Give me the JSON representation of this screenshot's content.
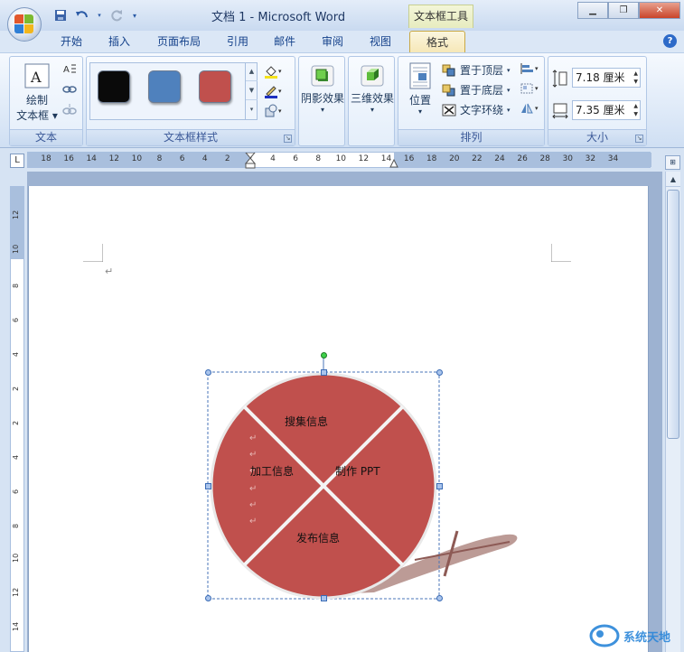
{
  "titlebar": {
    "document_title": "文档 1 - Microsoft Word",
    "contextual_tab_title": "文本框工具",
    "window_buttons": [
      "minimize",
      "restore",
      "close"
    ]
  },
  "tabs": [
    {
      "label": "开始",
      "active": false
    },
    {
      "label": "插入",
      "active": false
    },
    {
      "label": "页面布局",
      "active": false
    },
    {
      "label": "引用",
      "active": false
    },
    {
      "label": "邮件",
      "active": false
    },
    {
      "label": "审阅",
      "active": false
    },
    {
      "label": "视图",
      "active": false
    },
    {
      "label": "格式",
      "active": true
    }
  ],
  "ribbon": {
    "text_group": {
      "label": "文本",
      "draw_textbox_line1": "绘制",
      "draw_textbox_line2": "文本框"
    },
    "textbox_styles_group": {
      "label": "文本框样式",
      "swatches": [
        "#0a0a0a",
        "#4f81bd",
        "#c0504d"
      ]
    },
    "shadow_group": {
      "label": "阴影效果"
    },
    "threed_group": {
      "label": "三维效果"
    },
    "arrange_group": {
      "label": "排列",
      "position_label": "位置",
      "bring_front": "置于顶层",
      "send_back": "置于底层",
      "text_wrap": "文字环绕"
    },
    "size_group": {
      "label": "大小",
      "height_value": "7.18 厘米",
      "width_value": "7.35 厘米"
    }
  },
  "ruler": {
    "labels": [
      "18",
      "16",
      "14",
      "12",
      "10",
      "8",
      "6",
      "4",
      "2",
      "2",
      "4",
      "6",
      "8",
      "10",
      "12",
      "14",
      "16",
      "18",
      "20",
      "22",
      "24",
      "26",
      "28",
      "30",
      "32",
      "34"
    ],
    "vertical_labels": [
      "12",
      "10",
      "8",
      "6",
      "4",
      "2",
      "2",
      "4",
      "6",
      "8",
      "10",
      "12",
      "14"
    ]
  },
  "diagram": {
    "fill_color": "#c0504d",
    "top_label": "搜集信息",
    "left_label": "加工信息",
    "right_label": "制作 PPT",
    "bottom_label": "发布信息"
  },
  "watermark": {
    "text": "系统天地"
  }
}
